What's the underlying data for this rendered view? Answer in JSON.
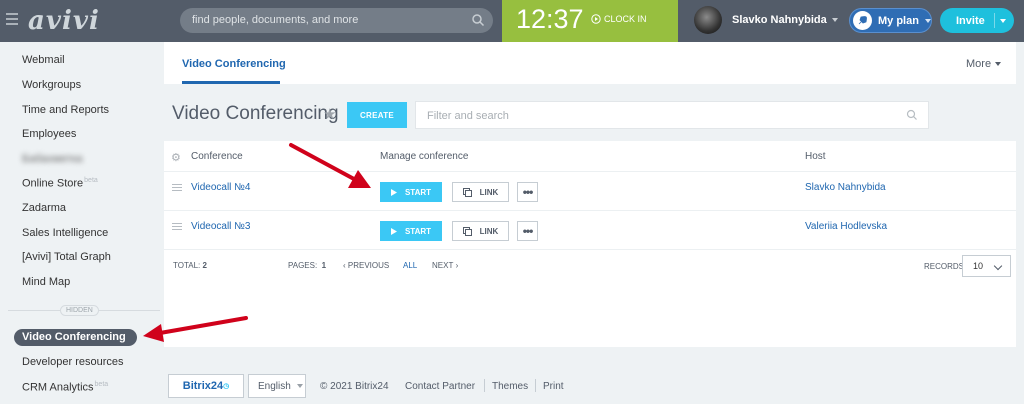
{
  "header": {
    "logo": "avivi",
    "search_placeholder": "find people, documents, and more",
    "clock_time": "12:37",
    "clock_in": "CLOCK IN",
    "user_name": "Slavko Nahnybida",
    "my_plan": "My plan",
    "invite": "Invite"
  },
  "sidebar": {
    "items": [
      {
        "label": "Webmail"
      },
      {
        "label": "Workgroups"
      },
      {
        "label": "Time and Reports"
      },
      {
        "label": "Employees"
      },
      {
        "label": "Бабахметка"
      },
      {
        "label": "Online Store",
        "badge": "beta"
      },
      {
        "label": "Zadarma"
      },
      {
        "label": "Sales Intelligence"
      },
      {
        "label": "[Avivi] Total Graph"
      },
      {
        "label": "Mind Map"
      }
    ],
    "hidden_label": "HIDDEN",
    "active_item": "Video Conferencing",
    "hidden_items": [
      {
        "label": "Developer resources"
      },
      {
        "label": "CRM Analytics",
        "badge": "beta"
      }
    ]
  },
  "tabs": {
    "active": "Video Conferencing",
    "more": "More"
  },
  "toolbar": {
    "title": "Video Conferencing",
    "create": "CREATE",
    "filter_placeholder": "Filter and search"
  },
  "grid": {
    "columns": [
      "Conference",
      "Manage conference",
      "Host"
    ],
    "rows": [
      {
        "conference": "Videocall №4",
        "start": "START",
        "link": "LINK",
        "host": "Slavko Nahnybida"
      },
      {
        "conference": "Videocall №3",
        "start": "START",
        "link": "LINK",
        "host": "Valeriia Hodlevska"
      }
    ],
    "footer": {
      "total_label": "TOTAL:",
      "total_value": "2",
      "pages_label": "PAGES:",
      "pages_value": "1",
      "previous": "PREVIOUS",
      "all": "ALL",
      "next": "NEXT",
      "records_label": "RECORDS:",
      "records_value": "10"
    }
  },
  "footer": {
    "bitrix": "Bitrix24",
    "language": "English",
    "copyright": "© 2021 Bitrix24",
    "contact": "Contact Partner",
    "themes": "Themes",
    "print": "Print"
  },
  "colors": {
    "header_bg": "#535c69",
    "clock_bg": "#97bf3f",
    "accent_blue": "#3bc8f5",
    "link_blue": "#2067b0",
    "invite_bg": "#1ec0dd",
    "arrow_red": "#d0021b"
  }
}
